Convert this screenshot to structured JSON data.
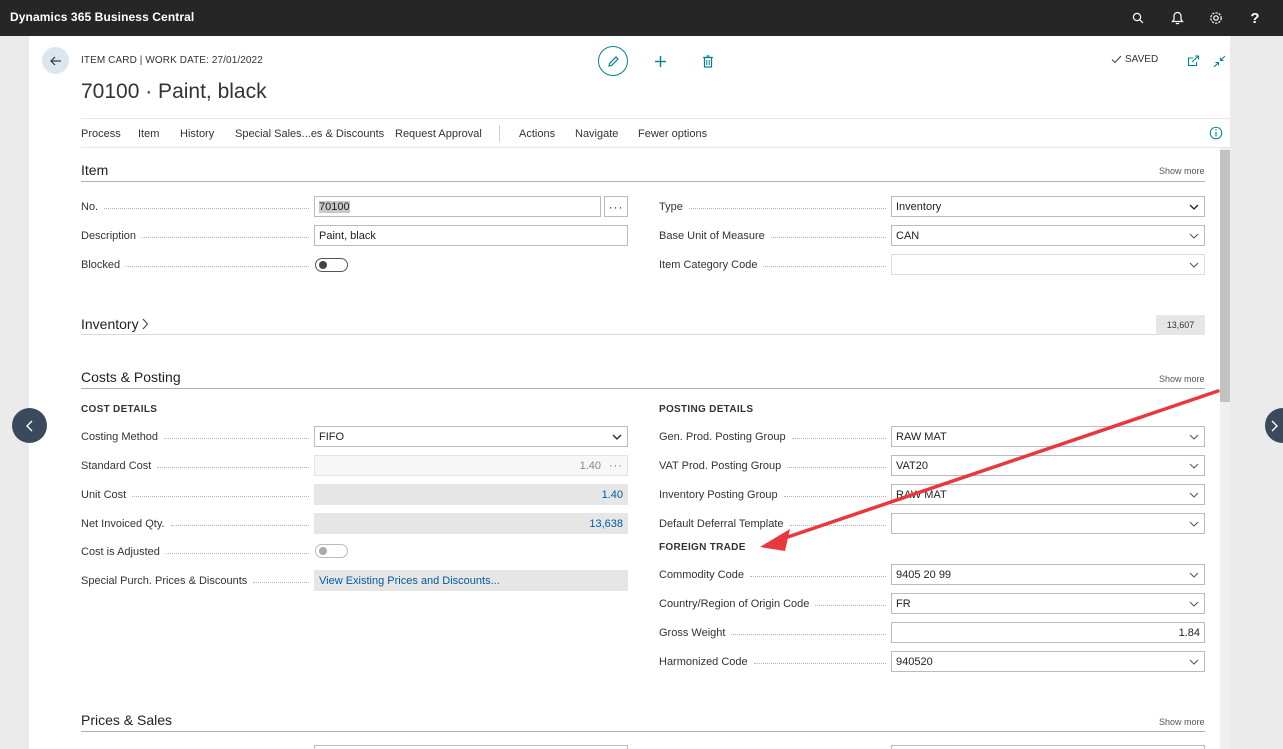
{
  "topbar": {
    "title": "Dynamics 365 Business Central"
  },
  "header": {
    "breadcrumb": "ITEM CARD | WORK DATE: 27/01/2022",
    "title": "70100 · Paint, black",
    "saved": "SAVED"
  },
  "actions": [
    "Process",
    "Item",
    "History",
    "Special Sales...es & Discounts",
    "Request Approval",
    "Actions",
    "Navigate",
    "Fewer options"
  ],
  "item": {
    "title": "Item",
    "show_more": "Show more",
    "no_label": "No.",
    "no_value": "70100",
    "desc_label": "Description",
    "desc_value": "Paint, black",
    "blocked_label": "Blocked",
    "type_label": "Type",
    "type_value": "Inventory",
    "base_uom_label": "Base Unit of Measure",
    "base_uom_value": "CAN",
    "cat_label": "Item Category Code",
    "cat_value": ""
  },
  "inventory": {
    "title": "Inventory",
    "value": "13,607"
  },
  "costs": {
    "title": "Costs & Posting",
    "show_more": "Show more",
    "cost_details": "COST DETAILS",
    "costing_method_label": "Costing Method",
    "costing_method_value": "FIFO",
    "standard_cost_label": "Standard Cost",
    "standard_cost_value": "1.40",
    "unit_cost_label": "Unit Cost",
    "unit_cost_value": "1.40",
    "net_inv_label": "Net Invoiced Qty.",
    "net_inv_value": "13,638",
    "cost_adj_label": "Cost is Adjusted",
    "special_purch_label": "Special Purch. Prices & Discounts",
    "special_purch_value": "View Existing Prices and Discounts...",
    "posting_details": "POSTING DETAILS",
    "gen_prod_label": "Gen. Prod. Posting Group",
    "gen_prod_value": "RAW MAT",
    "vat_prod_label": "VAT Prod. Posting Group",
    "vat_prod_value": "VAT20",
    "inv_posting_label": "Inventory Posting Group",
    "inv_posting_value": "RAW MAT",
    "deferral_label": "Default Deferral Template",
    "deferral_value": "",
    "foreign_trade": "FOREIGN TRADE",
    "commodity_label": "Commodity Code",
    "commodity_value": "9405 20 99",
    "origin_label": "Country/Region of Origin Code",
    "origin_value": "FR",
    "gross_weight_label": "Gross Weight",
    "gross_weight_value": "1.84",
    "harmonized_label": "Harmonized Code",
    "harmonized_value": "940520"
  },
  "prices": {
    "title": "Prices & Sales",
    "show_more": "Show more"
  },
  "colors": {
    "topbar": "#262626",
    "accent": "#00838f",
    "annotation_arrow": "#e8383d"
  }
}
